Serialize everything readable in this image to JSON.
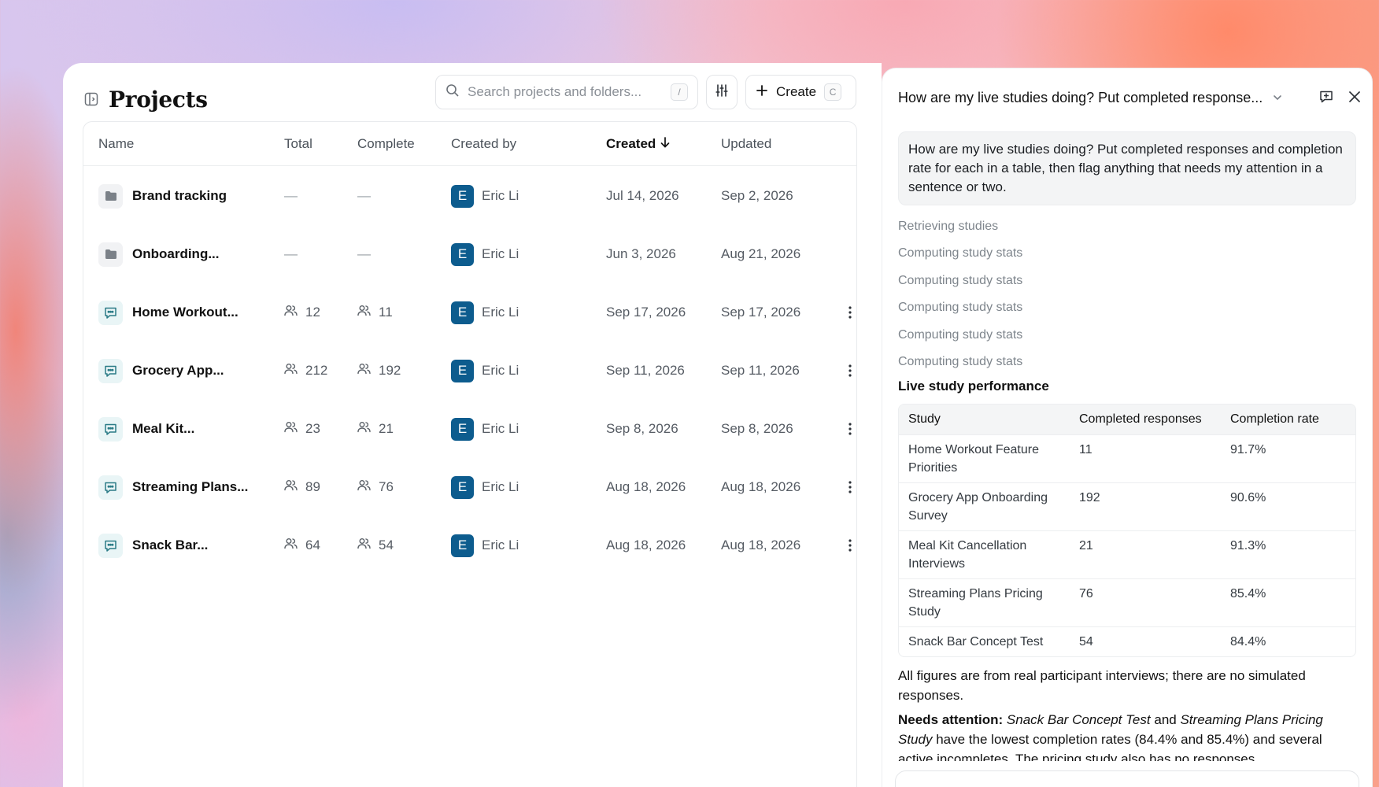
{
  "projects_window": {
    "title": "Projects",
    "search": {
      "placeholder": "Search projects and folders...",
      "shortcut": "/"
    },
    "create": {
      "label": "Create",
      "shortcut": "C"
    },
    "columns": {
      "name": "Name",
      "total": "Total",
      "complete": "Complete",
      "created_by": "Created by",
      "created": "Created",
      "updated": "Updated"
    },
    "sort": {
      "column": "created",
      "direction": "descending",
      "icon": "arrow-down-icon"
    },
    "rows": [
      {
        "type": "folder",
        "name": "Brand tracking",
        "total": "—",
        "complete": "—",
        "avatar_initial": "E",
        "created_by": "Eric Li",
        "created": "Jul 14, 2026",
        "updated": "Sep 2, 2026",
        "has_menu": false
      },
      {
        "type": "folder",
        "name": "Onboarding...",
        "total": "—",
        "complete": "—",
        "avatar_initial": "E",
        "created_by": "Eric Li",
        "created": "Jun 3, 2026",
        "updated": "Aug 21, 2026",
        "has_menu": false
      },
      {
        "type": "study",
        "name": "Home Workout...",
        "total": "12",
        "complete": "11",
        "avatar_initial": "E",
        "created_by": "Eric Li",
        "created": "Sep 17, 2026",
        "updated": "Sep 17, 2026",
        "has_menu": true
      },
      {
        "type": "study",
        "name": "Grocery App...",
        "total": "212",
        "complete": "192",
        "avatar_initial": "E",
        "created_by": "Eric Li",
        "created": "Sep 11, 2026",
        "updated": "Sep 11, 2026",
        "has_menu": true
      },
      {
        "type": "study",
        "name": "Meal Kit...",
        "total": "23",
        "complete": "21",
        "avatar_initial": "E",
        "created_by": "Eric Li",
        "created": "Sep 8, 2026",
        "updated": "Sep 8, 2026",
        "has_menu": true
      },
      {
        "type": "study",
        "name": "Streaming Plans...",
        "total": "89",
        "complete": "76",
        "avatar_initial": "E",
        "created_by": "Eric Li",
        "created": "Aug 18, 2026",
        "updated": "Aug 18, 2026",
        "has_menu": true
      },
      {
        "type": "study",
        "name": "Snack Bar...",
        "total": "64",
        "complete": "54",
        "avatar_initial": "E",
        "created_by": "Eric Li",
        "created": "Aug 18, 2026",
        "updated": "Aug 18, 2026",
        "has_menu": true
      }
    ]
  },
  "assistant": {
    "title": "How are my live studies doing? Put completed response...",
    "user_message": "How are my live studies doing? Put completed responses and completion rate for each in a table, then flag anything that needs my attention in a sentence or two.",
    "steps": [
      "Retrieving studies",
      "Computing study stats",
      "Computing study stats",
      "Computing study stats",
      "Computing study stats",
      "Computing study stats"
    ],
    "table_heading": "Live study performance",
    "table_columns": [
      "Study",
      "Completed responses",
      "Completion rate"
    ],
    "table_rows": [
      [
        "Home Workout Feature Priorities",
        "11",
        "91.7%"
      ],
      [
        "Grocery App Onboarding Survey",
        "192",
        "90.6%"
      ],
      [
        "Meal Kit Cancellation Interviews",
        "21",
        "91.3%"
      ],
      [
        "Streaming Plans Pricing Study",
        "76",
        "85.4%"
      ],
      [
        "Snack Bar Concept Test",
        "54",
        "84.4%"
      ]
    ],
    "summary": "All figures are from real participant interviews; there are no simulated responses.",
    "attention": {
      "label": "Needs attention:",
      "study_a": "Snack Bar Concept Test",
      "joiner": "and",
      "study_b": "Streaming Plans Pricing Study",
      "text": "have the lowest completion rates (84.4% and 85.4%) and several active incompletes. The pricing study also has no responses"
    }
  },
  "colors": {
    "avatar": "#0d5c8e",
    "study_icon_bg": "#e9f5f6",
    "folder_icon_bg": "#f1f2f4"
  }
}
